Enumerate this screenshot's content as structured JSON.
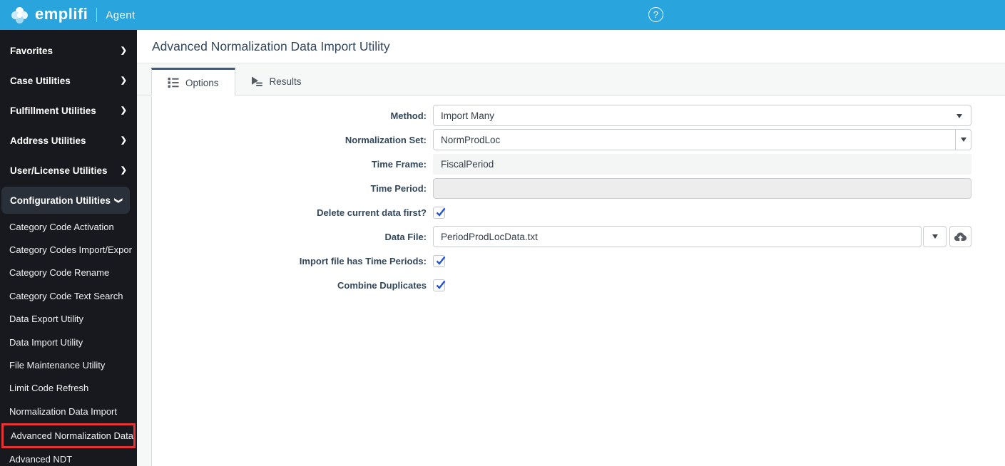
{
  "header": {
    "brand": "emplifi",
    "product": "Agent",
    "help_icon": "question-mark-circle",
    "bg_color": "#2AA4DC"
  },
  "sidebar": {
    "bg_color": "#17191E",
    "items": [
      {
        "label": "Favorites",
        "chevron": "right"
      },
      {
        "label": "Case Utilities",
        "chevron": "right"
      },
      {
        "label": "Fulfillment Utilities",
        "chevron": "right"
      },
      {
        "label": "Address Utilities",
        "chevron": "right"
      },
      {
        "label": "User/License Utilities",
        "chevron": "right"
      },
      {
        "label": "Configuration Utilities",
        "chevron": "down",
        "expanded": true
      }
    ],
    "subitems": [
      "Category Code Activation",
      "Category Codes Import/Expor",
      "Category Code Rename",
      "Category Code Text Search",
      "Data Export Utility",
      "Data Import Utility",
      "File Maintenance Utility",
      "Limit Code Refresh",
      "Normalization Data Import",
      "Advanced Normalization Data",
      "Advanced NDT"
    ],
    "highlighted_item": "Advanced Normalization Data",
    "highlight_color": "#E53232"
  },
  "main": {
    "title": "Advanced Normalization Data Import Utility",
    "tabs": [
      {
        "label": "Options",
        "icon": "list-icon",
        "active": true
      },
      {
        "label": "Results",
        "icon": "run-results-icon",
        "active": false
      }
    ],
    "tab_accent_color": "#3C5A80",
    "form": {
      "method": {
        "label": "Method:",
        "value": "Import Many"
      },
      "normalization_set": {
        "label": "Normalization Set:",
        "value": "NormProdLoc"
      },
      "time_frame": {
        "label": "Time Frame:",
        "value": "FiscalPeriod"
      },
      "time_period": {
        "label": "Time Period:",
        "value": ""
      },
      "delete_first": {
        "label": "Delete current data first?",
        "checked": true
      },
      "data_file": {
        "label": "Data File:",
        "value": "PeriodProdLocData.txt",
        "upload_icon": "cloud-upload-icon"
      },
      "import_has_time_periods": {
        "label": "Import file has Time Periods:",
        "checked": true
      },
      "combine_duplicates": {
        "label": "Combine Duplicates",
        "checked": true
      },
      "check_color": "#2254D3"
    }
  }
}
